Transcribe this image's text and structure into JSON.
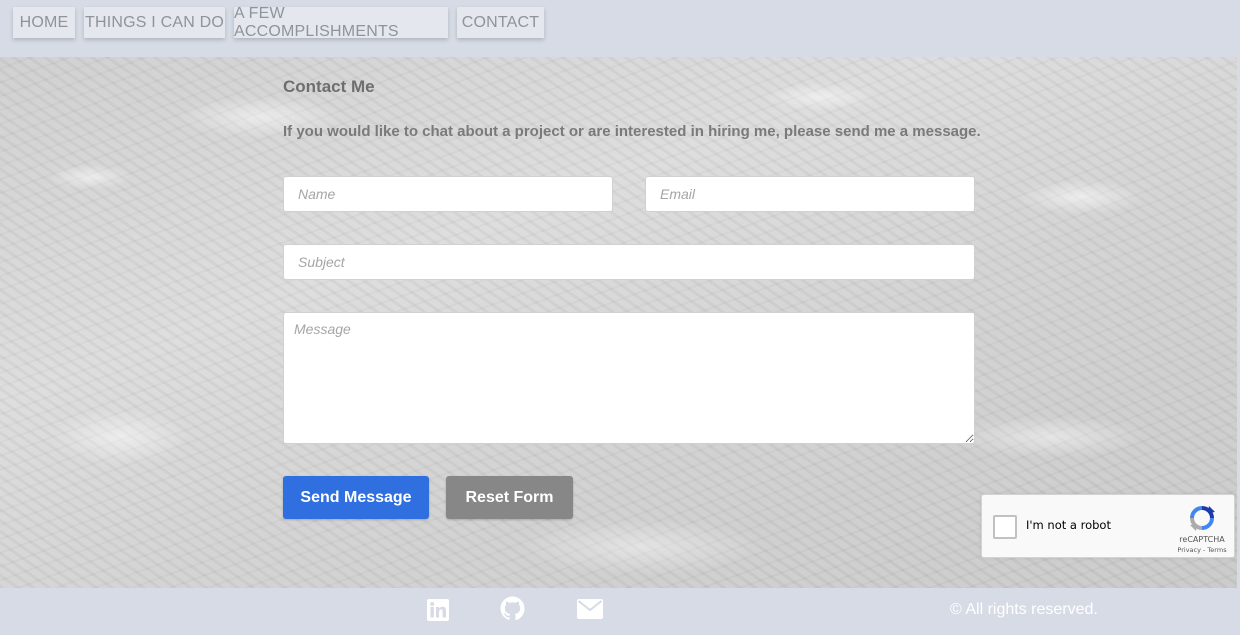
{
  "nav": {
    "items": [
      {
        "label": "HOME"
      },
      {
        "label": "THINGS I CAN DO"
      },
      {
        "label": "A FEW ACCOMPLISHMENTS"
      },
      {
        "label": "CONTACT"
      }
    ]
  },
  "contact": {
    "heading": "Contact Me",
    "intro": "If you would like to chat about a project or are interested in hiring me, please send me a message.",
    "fields": {
      "name_placeholder": "Name",
      "email_placeholder": "Email",
      "subject_placeholder": "Subject",
      "message_placeholder": "Message"
    },
    "send_label": "Send Message",
    "reset_label": "Reset Form"
  },
  "recaptcha": {
    "label": "I'm not a robot",
    "brand": "reCAPTCHA",
    "links": "Privacy - Terms",
    "checked": false
  },
  "footer": {
    "icons": [
      "linkedin-icon",
      "github-icon",
      "mail-icon"
    ],
    "copyright": "© All rights reserved."
  },
  "colors": {
    "send_button": "#2f6fe0",
    "reset_button": "#878787",
    "nav_bg": "#d6dbe5"
  }
}
